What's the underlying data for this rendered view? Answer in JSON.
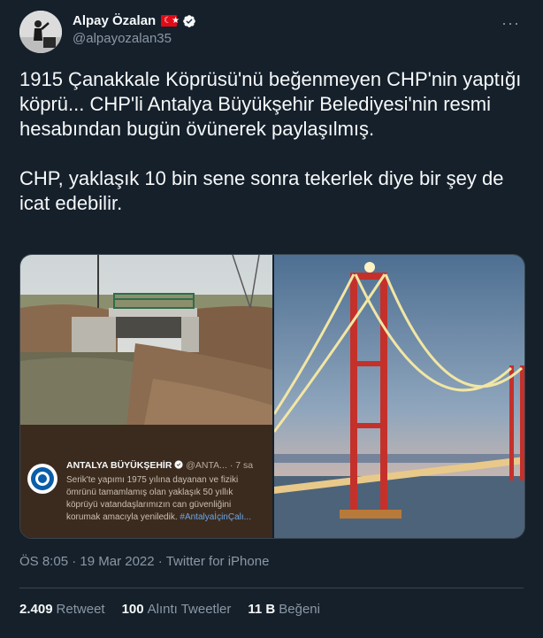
{
  "author": {
    "name": "Alpay Özalan",
    "handle": "@alpayozalan35",
    "flag_glyph": "☾★"
  },
  "tweet": {
    "text": "1915 Çanakkale Köprüsü'nü beğenmeyen CHP'nin yaptığı köprü... CHP'li Antalya Büyükşehir Belediyesi'nin resmi hesabından bugün övünerek paylaşılmış.\n\nCHP, yaklaşık 10 bin sene sonra tekerlek diye bir şey de icat edebilir.",
    "time": "ÖS 8:05",
    "date": "19 Mar 2022",
    "via": "Twitter for iPhone"
  },
  "embed": {
    "name": "ANTALYA BÜYÜKŞEHİR",
    "handle": "@ANTA...",
    "age": "· 7 sa",
    "body": "Serik'te yapımı 1975 yılına dayanan ve fiziki ömrünü tamamlamış olan yaklaşık 50 yıllık köprüyü vatandaşlarımızın can güvenliğini korumak amacıyla yeniledik.",
    "hashtag": "#AntalyaİçinÇalı..."
  },
  "stats": {
    "retweets": "2.409",
    "retweets_label": "Retweet",
    "quotes": "100",
    "quotes_label": "Alıntı Tweetler",
    "likes": "11 B",
    "likes_label": "Beğeni"
  },
  "colors": {
    "background": "#15202b",
    "text": "#f7f9f9",
    "secondary": "#8b98a5",
    "verified": "#1d9bf0",
    "flag": "#e30a17"
  },
  "icons": [
    "more-icon",
    "verified-badge-icon",
    "turkish-flag-icon"
  ]
}
